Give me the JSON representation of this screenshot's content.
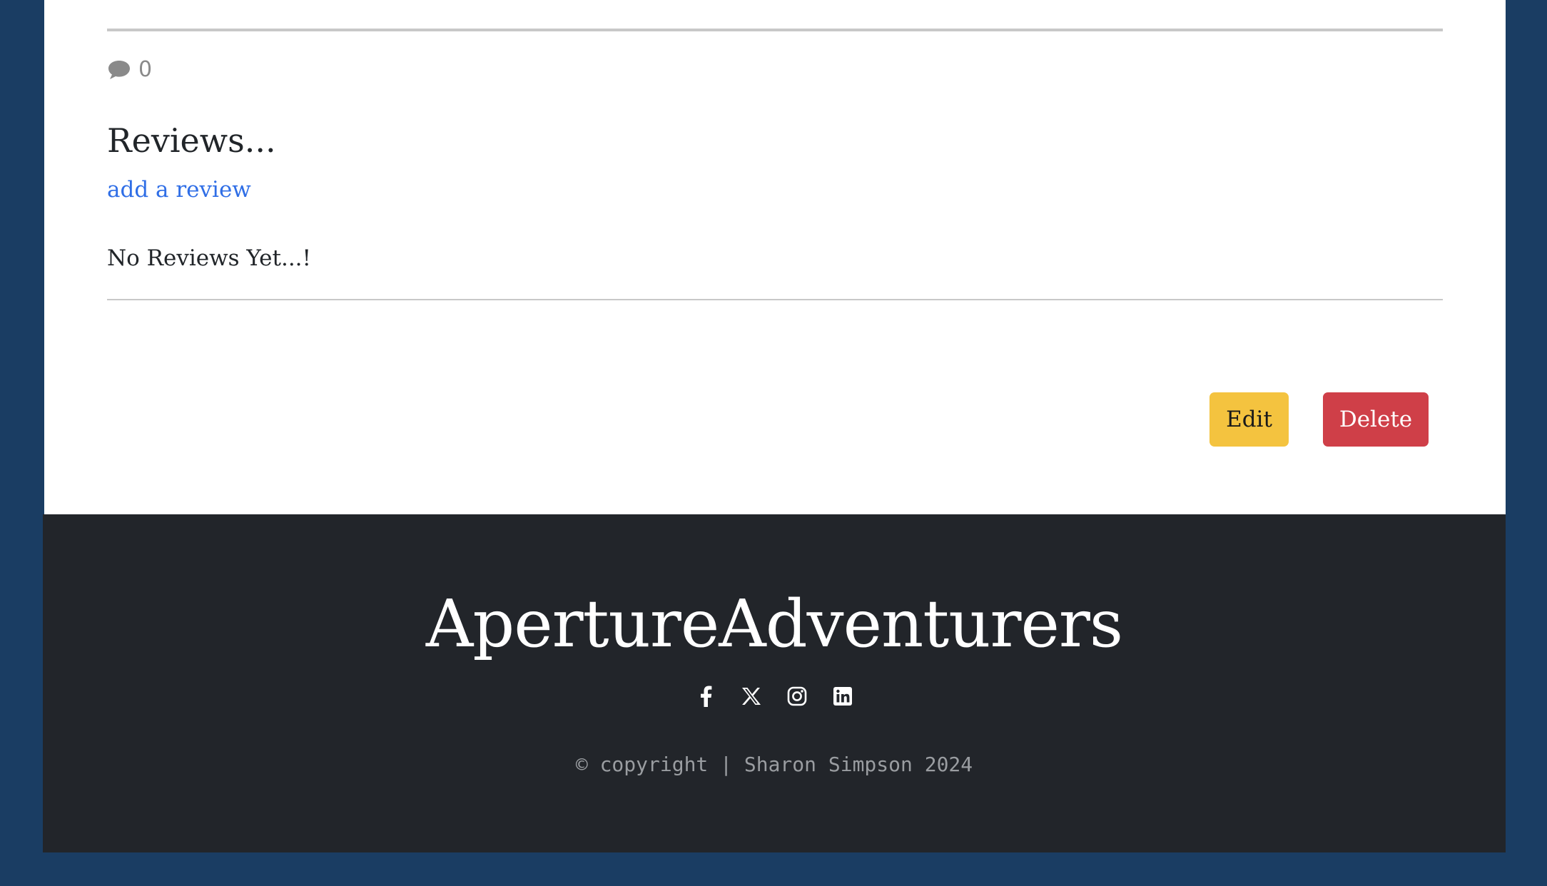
{
  "post": {
    "comment_icon": "comment-icon",
    "comment_count": "0"
  },
  "reviews": {
    "title": "Reviews...",
    "add_link": "add a review",
    "empty_text": "No Reviews Yet...!"
  },
  "actions": {
    "edit_label": "Edit",
    "delete_label": "Delete",
    "edit_color": "#f4c33f",
    "delete_color": "#cf3f48"
  },
  "footer": {
    "brand": "ApertureAdventurers",
    "socials": [
      "facebook-icon",
      "x-twitter-icon",
      "instagram-icon",
      "linkedin-icon"
    ],
    "copyright_symbol": "©",
    "copyright_text": "copyright | Sharon Simpson 2024"
  },
  "colors": {
    "page_background": "#1a3d63",
    "footer_background": "#22252a",
    "link": "#2f6ee6"
  }
}
